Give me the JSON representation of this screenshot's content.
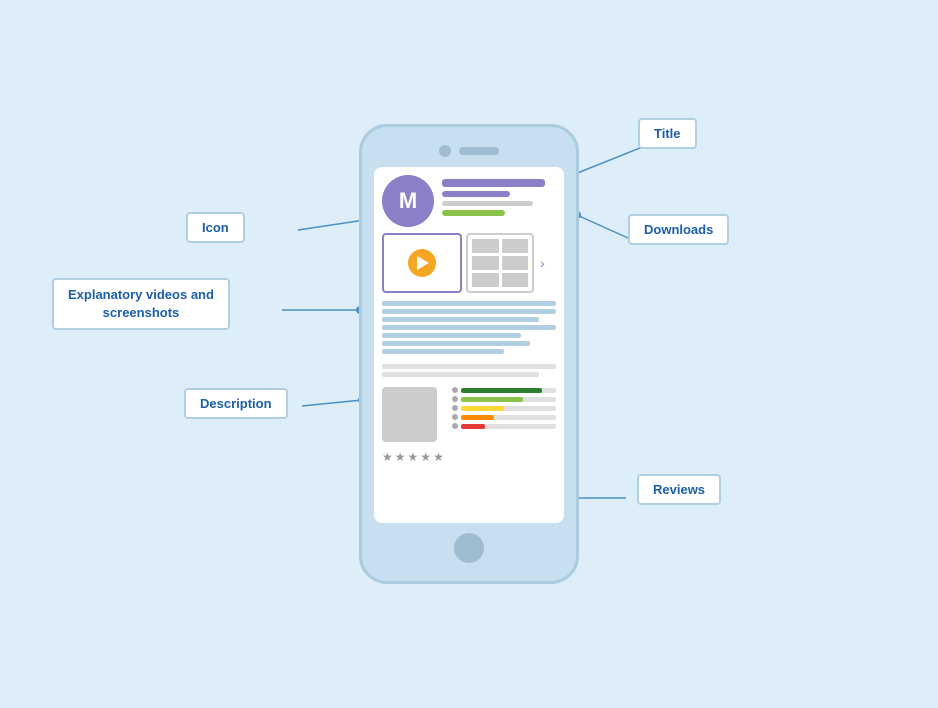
{
  "labels": {
    "title": "Title",
    "icon": "Icon",
    "downloads": "Downloads",
    "explanatory": "Explanatory videos and\nscreenshots",
    "description": "Description",
    "reviews": "Reviews"
  },
  "phone": {
    "app_icon_letter": "M",
    "stars": [
      "★",
      "★",
      "★",
      "★",
      "★"
    ]
  },
  "rating_bars": [
    {
      "color": "rb-green",
      "width": "85%"
    },
    {
      "color": "rb-light-green",
      "width": "65%"
    },
    {
      "color": "rb-yellow",
      "width": "45%"
    },
    {
      "color": "rb-orange",
      "width": "35%"
    },
    {
      "color": "rb-red",
      "width": "25%"
    }
  ]
}
